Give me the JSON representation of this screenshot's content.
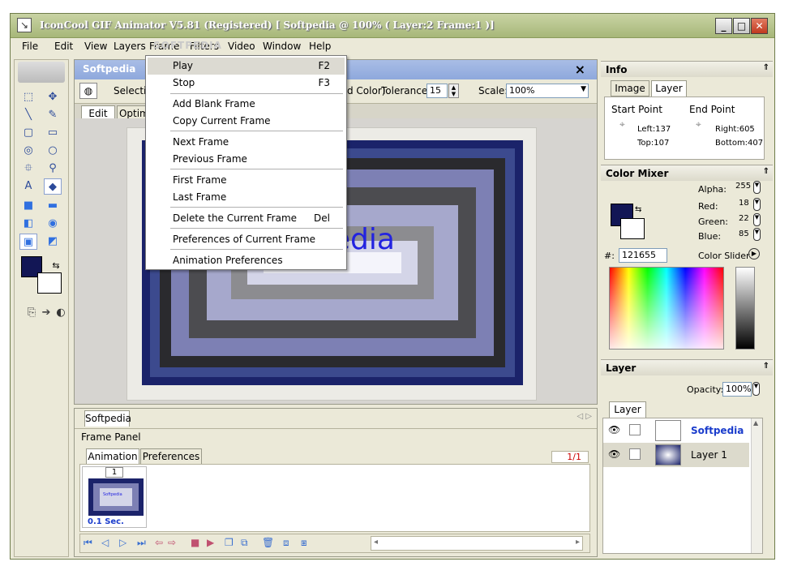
{
  "window": {
    "title": "IconCool GIF Animator V5.81 (Registered) [ Softpedia @ 100% ( Layer:2 Frame:1 )]"
  },
  "menubar": [
    "File",
    "Edit",
    "View",
    "Layers",
    "Frame",
    "Filters",
    "Video",
    "Window",
    "Help"
  ],
  "watermark": "SOFTPEDIA",
  "doc": {
    "title": "Softpedia",
    "selection_label": "Selectio",
    "color_suffix": "d Color)",
    "tolerance_label": "Tolerance:",
    "tolerance_value": "15",
    "scale_label": "Scale:",
    "scale_value": "100%",
    "tab_edit": "Edit",
    "tab_optimize": "Optimi",
    "canvas_text": "pedia"
  },
  "frame_menu": {
    "items": [
      {
        "label": "Play",
        "shortcut": "F2"
      },
      {
        "label": "Stop",
        "shortcut": "F3"
      },
      {
        "label": "Add Blank Frame",
        "shortcut": ""
      },
      {
        "label": "Copy Current Frame",
        "shortcut": ""
      },
      {
        "label": "Next Frame",
        "shortcut": ""
      },
      {
        "label": "Previous Frame",
        "shortcut": ""
      },
      {
        "label": "First Frame",
        "shortcut": ""
      },
      {
        "label": "Last Frame",
        "shortcut": ""
      },
      {
        "label": "Delete the Current Frame",
        "shortcut": "Del"
      },
      {
        "label": "Preferences of Current Frame",
        "shortcut": ""
      },
      {
        "label": "Animation Preferences",
        "shortcut": ""
      }
    ]
  },
  "frame_panel": {
    "doc_tab": "Softpedia",
    "title": "Frame Panel",
    "tab_animation": "Animation",
    "tab_preferences": "Preferences",
    "counter": "1/1",
    "frame_number": "1",
    "frame_delay": "0.1 Sec.",
    "thumb_text": "Softpedia"
  },
  "info": {
    "title": "Info",
    "tab_image": "Image",
    "tab_layer": "Layer",
    "start_point": "Start Point",
    "end_point": "End Point",
    "left": "Left:137",
    "top": "Top:107",
    "right": "Right:605",
    "bottom": "Bottom:407"
  },
  "color_mixer": {
    "title": "Color Mixer",
    "alpha_label": "Alpha:",
    "alpha": "255",
    "red_label": "Red:",
    "red": "18",
    "green_label": "Green:",
    "green": "22",
    "blue_label": "Blue:",
    "blue": "85",
    "hash_label": "#:",
    "hex": "121655",
    "slider_label": "Color Slider",
    "fg_color": "#121655"
  },
  "layer_panel": {
    "title": "Layer",
    "opacity_label": "Opacity:",
    "opacity": "100%",
    "tab": "Layer",
    "layers": [
      "Softpedia",
      "Layer 1"
    ]
  }
}
